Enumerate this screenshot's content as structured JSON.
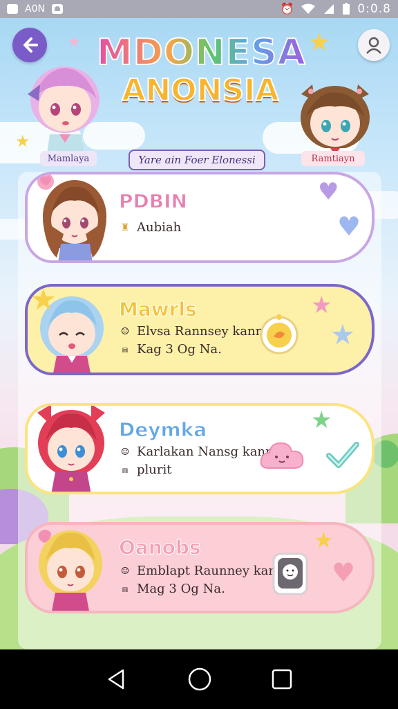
{
  "status_bar": {
    "carrier": "A0N",
    "time": "0:0.8"
  },
  "header": {
    "title_line1": "MDONESA",
    "title_line2": "ANONSIA",
    "subtitle": "Yare ain Foer Elonessi",
    "left_avatar_name": "Mamlaya",
    "right_avatar_name": "Ramtiayn"
  },
  "characters": [
    {
      "name": "PDBIN",
      "line1": "Aubiah",
      "line2": "",
      "hair_color": "#9b5a34",
      "accent": "#e780b1"
    },
    {
      "name": "Mawrls",
      "line1": "Elvsa Rannsey kann",
      "line2": "Kag 3 Og Na.",
      "hair_color": "#a9d3f0",
      "accent": "#f3c23c"
    },
    {
      "name": "Deymka",
      "line1": "Karlakan Nansg kann",
      "line2": "plurit",
      "hair_color": "#e23e57",
      "accent": "#63a7e6"
    },
    {
      "name": "Oanobs",
      "line1": "Emblapt Raunney kam",
      "line2": "Mag 3 Og Na.",
      "hair_color": "#f3d25f",
      "accent": "#f59fb3"
    }
  ],
  "icons": {
    "back": "arrow-left",
    "profile": "user",
    "nav_back": "triangle",
    "nav_home": "circle",
    "nav_recent": "square"
  }
}
